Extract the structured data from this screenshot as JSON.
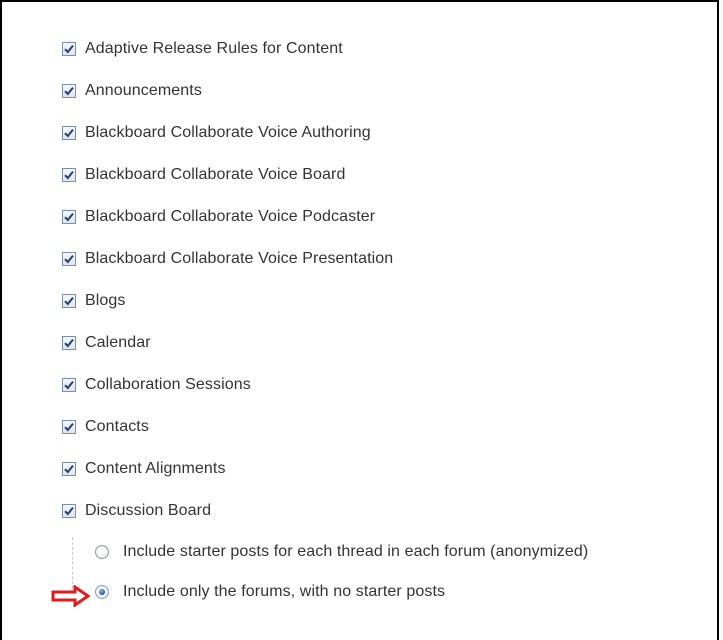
{
  "options": [
    {
      "label": "Adaptive Release Rules for Content",
      "checked": true
    },
    {
      "label": "Announcements",
      "checked": true
    },
    {
      "label": "Blackboard Collaborate Voice Authoring",
      "checked": true
    },
    {
      "label": "Blackboard Collaborate Voice Board",
      "checked": true
    },
    {
      "label": "Blackboard Collaborate Voice Podcaster",
      "checked": true
    },
    {
      "label": "Blackboard Collaborate Voice Presentation",
      "checked": true
    },
    {
      "label": "Blogs",
      "checked": true
    },
    {
      "label": "Calendar",
      "checked": true
    },
    {
      "label": "Collaboration Sessions",
      "checked": true
    },
    {
      "label": "Contacts",
      "checked": true
    },
    {
      "label": "Content Alignments",
      "checked": true
    },
    {
      "label": "Discussion Board",
      "checked": true
    }
  ],
  "discussion_board_options": [
    {
      "label": "Include starter posts for each thread in each forum (anonymized)",
      "selected": false
    },
    {
      "label": "Include only the forums, with no starter posts",
      "selected": true
    }
  ],
  "colors": {
    "text": "#333333",
    "annotation_arrow": "#e11b1b",
    "frame_border": "#000000",
    "radio_selected": "#1d5aa6"
  },
  "icons": {
    "checkbox": "checkmark-icon",
    "annotation": "red-arrow-icon"
  }
}
